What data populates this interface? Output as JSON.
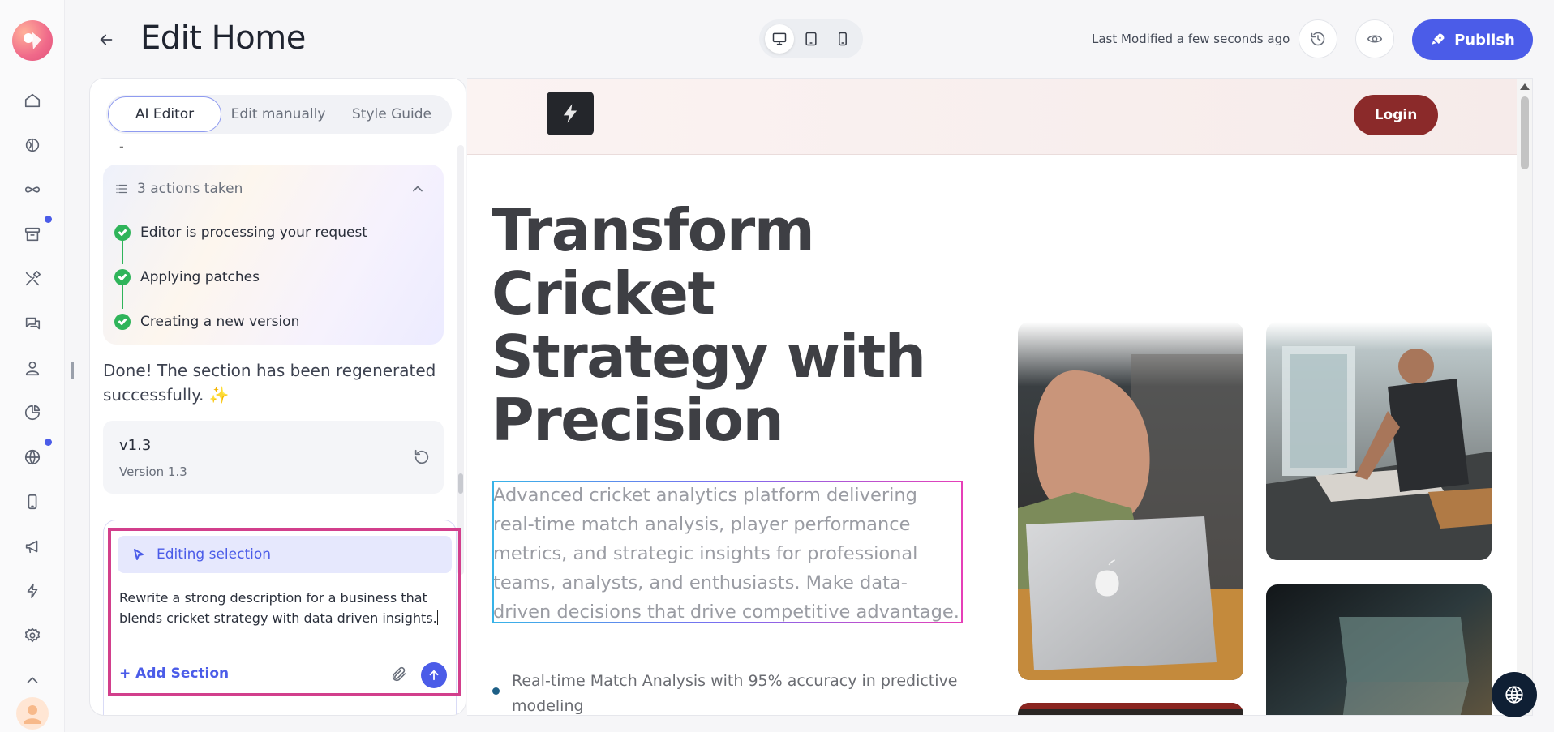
{
  "header": {
    "title": "Edit Home",
    "last_modified": "Last Modified a few seconds ago",
    "publish_label": "Publish",
    "device_modes": [
      "desktop-icon",
      "tablet-icon",
      "mobile-icon"
    ],
    "active_device": "desktop"
  },
  "rail": {
    "items": [
      "home-icon",
      "brain-icon",
      "infinity-icon",
      "archive-icon",
      "tools-icon",
      "chat-icon",
      "user-icon",
      "pie-chart-icon",
      "globe-icon",
      "phone-icon",
      "megaphone-icon",
      "bolt-icon",
      "settings-icon",
      "chevron-up-icon"
    ],
    "badges": [
      "archive-icon",
      "globe-icon"
    ]
  },
  "editor": {
    "tabs": [
      {
        "label": "AI Editor",
        "active": true
      },
      {
        "label": "Edit manually",
        "active": false
      },
      {
        "label": "Style Guide",
        "active": false
      }
    ],
    "dash": "-",
    "actions": {
      "title": "3 actions taken",
      "steps": [
        "Editor is processing your request",
        "Applying patches",
        "Creating a new version"
      ]
    },
    "done_message": "Done! The section has been regenerated successfully. ✨",
    "version": {
      "tag": "v1.3",
      "subtitle": "Version 1.3"
    },
    "composer": {
      "selection_label": "Editing selection",
      "prompt": "Rewrite a strong description for a business that blends cricket strategy with data driven insights.",
      "add_section_label": "+ Add Section"
    }
  },
  "preview": {
    "login_label": "Login",
    "hero_title": "Transform Cricket Strategy with Precision",
    "hero_description": "Advanced cricket analytics platform delivering real-time match analysis, player performance metrics, and strategic insights for professional teams, analysts, and enthusiasts. Make data-driven decisions that drive competitive advantage.",
    "bullet": "Real-time Match Analysis with 95% accuracy in predictive modeling"
  },
  "colors": {
    "accent": "#4b5ce8",
    "login": "#8b2a2a",
    "selection_outline": "#d23f8c",
    "success": "#2fb45a"
  }
}
